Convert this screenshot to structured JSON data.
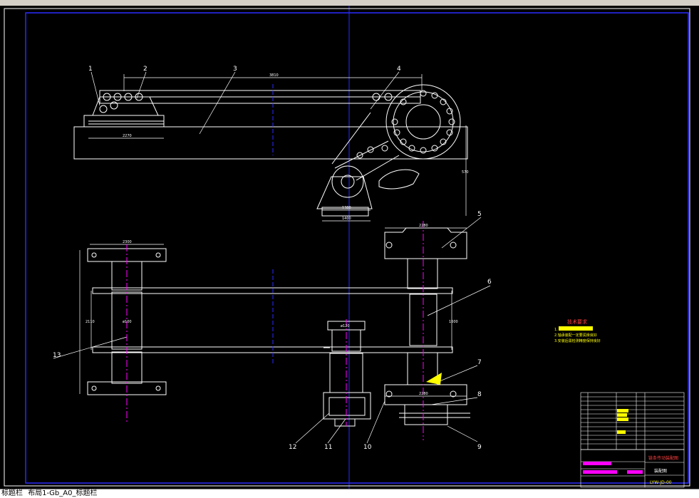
{
  "balloons": [
    "1",
    "2",
    "3",
    "4",
    "5",
    "6",
    "7",
    "8",
    "9",
    "10",
    "11",
    "12",
    "13"
  ],
  "dimensions": {
    "top_span": "3810",
    "base_width": "2270",
    "pedestal_inner": "1300",
    "pedestal_outer": "1400",
    "vertical_height": "570",
    "left_bearing": "2300",
    "right_block": "2280",
    "shaft_dia": "ø100",
    "left_vertical": "2110",
    "right_vertical": "1600",
    "small_block": "ø120",
    "bottom_bearing": "2280"
  },
  "notes": {
    "title": "技术要求",
    "items": [
      "1.",
      "2.轴承装配一定要润滑良好",
      "3.安装后需检测精度保持良好"
    ]
  },
  "title_block": {
    "drawing_title": "链条传动装配图",
    "part_label": "装配图",
    "code": "LYW-JD-00"
  },
  "tabs": [
    "标题栏",
    "布局1-Gb_A0_标题栏"
  ],
  "colors": {
    "background": "#000000",
    "lines": "#ffffff",
    "centerline": "#ff00ff",
    "frame": "#0000ff",
    "highlight": "#ffff00"
  }
}
